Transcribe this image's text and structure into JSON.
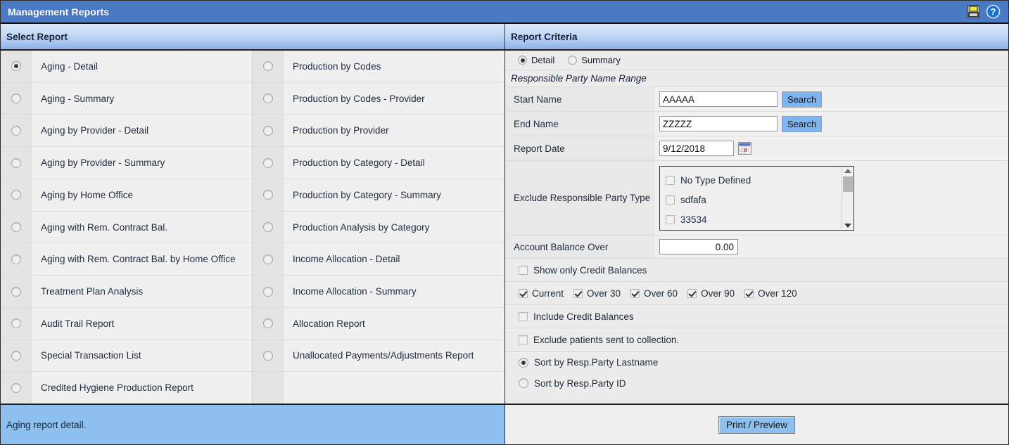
{
  "window": {
    "title": "Management Reports",
    "icons": [
      {
        "name": "print-icon",
        "label": "Print"
      },
      {
        "name": "help-icon",
        "label": "Help"
      }
    ]
  },
  "left_panel": {
    "header": "Select Report",
    "status_text": "Aging report detail.",
    "column1": [
      {
        "label": "Aging - Detail",
        "selected": true
      },
      {
        "label": "Aging - Summary",
        "selected": false
      },
      {
        "label": "Aging by Provider - Detail",
        "selected": false
      },
      {
        "label": "Aging by Provider - Summary",
        "selected": false
      },
      {
        "label": "Aging by Home Office",
        "selected": false
      },
      {
        "label": "Aging with Rem. Contract Bal.",
        "selected": false
      },
      {
        "label": "Aging with Rem. Contract Bal. by Home Office",
        "selected": false
      },
      {
        "label": "Treatment Plan Analysis",
        "selected": false
      },
      {
        "label": "Audit Trail Report",
        "selected": false
      },
      {
        "label": "Special Transaction List",
        "selected": false
      },
      {
        "label": "Credited Hygiene Production Report",
        "selected": false
      }
    ],
    "column2": [
      {
        "label": "Production by Codes",
        "selected": false
      },
      {
        "label": "Production by Codes - Provider",
        "selected": false
      },
      {
        "label": "Production by Provider",
        "selected": false
      },
      {
        "label": "Production by Category - Detail",
        "selected": false
      },
      {
        "label": "Production by Category - Summary",
        "selected": false
      },
      {
        "label": "Production Analysis by Category",
        "selected": false
      },
      {
        "label": "Income Allocation - Detail",
        "selected": false
      },
      {
        "label": "Income Allocation - Summary",
        "selected": false
      },
      {
        "label": "Allocation Report",
        "selected": false
      },
      {
        "label": "Unallocated Payments/Adjustments Report",
        "selected": false
      },
      {
        "label": "",
        "selected": false,
        "empty": true
      }
    ]
  },
  "right_panel": {
    "header": "Report Criteria",
    "mode": {
      "detail_label": "Detail",
      "detail_selected": true,
      "summary_label": "Summary",
      "summary_selected": false
    },
    "group_caption": "Responsible Party Name Range",
    "fields": {
      "start_name_label": "Start Name",
      "start_name_value": "AAAAA",
      "start_name_search": "Search",
      "end_name_label": "End Name",
      "end_name_value": "ZZZZZ",
      "end_name_search": "Search",
      "report_date_label": "Report Date",
      "report_date_value": "9/12/2018",
      "exclude_type_label": "Exclude Responsible Party Type",
      "account_balance_label": "Account Balance Over",
      "account_balance_value": "0.00"
    },
    "exclude_party_types": [
      {
        "label": "No Type Defined",
        "checked": false
      },
      {
        "label": "sdfafa",
        "checked": false
      },
      {
        "label": "33534",
        "checked": false
      }
    ],
    "options": {
      "show_only_credit_label": "Show only Credit Balances",
      "show_only_credit_checked": false,
      "include_credit_label": "Include Credit Balances",
      "include_credit_checked": false,
      "exclude_collection_label": "Exclude patients sent to collection.",
      "exclude_collection_checked": false
    },
    "aging_buckets": [
      {
        "label": "Current",
        "checked": true
      },
      {
        "label": "Over 30",
        "checked": true
      },
      {
        "label": "Over 60",
        "checked": true
      },
      {
        "label": "Over 90",
        "checked": true
      },
      {
        "label": "Over 120",
        "checked": true
      }
    ],
    "sort": {
      "lastname_label": "Sort by Resp.Party Lastname",
      "lastname_selected": true,
      "id_label": "Sort by Resp.Party ID",
      "id_selected": false
    },
    "print_button": "Print / Preview"
  },
  "colors": {
    "titlebar": "#4a7ac4",
    "header_top": "#dbe7fa",
    "header_bottom": "#8cb1e9",
    "status_bar": "#8ec0ef",
    "button_blue": "#7eb4ef",
    "panel_bg": "#f0f0f0"
  }
}
